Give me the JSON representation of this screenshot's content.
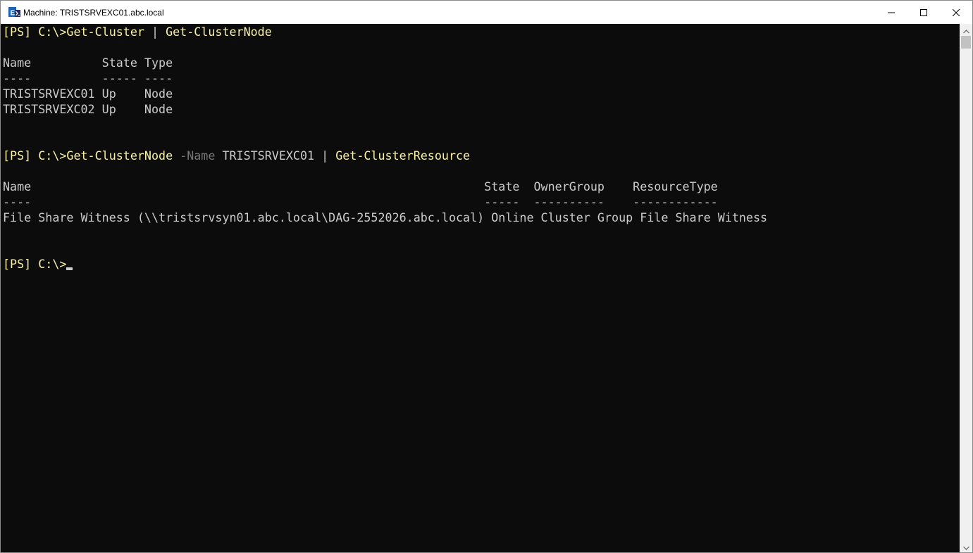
{
  "window": {
    "title": "Machine: TRISTSRVEXC01.abc.local",
    "icon": "exchange-management-shell-icon",
    "controls": [
      "minimize-icon",
      "maximize-icon",
      "close-icon"
    ]
  },
  "console": {
    "colors": {
      "background": "#0c0c0c",
      "text": "#cccccc",
      "command": "#f9f1a5",
      "parameter": "#767676"
    },
    "lines": {
      "l1": {
        "prompt": "[PS] C:\\>",
        "cmd1": "Get-Cluster",
        "pipe": " | ",
        "cmd2": "Get-ClusterNode"
      },
      "l3": "Name          State Type",
      "l4": "----          ----- ----",
      "l5": "TRISTSRVEXC01 Up    Node",
      "l6": "TRISTSRVEXC02 Up    Node",
      "l9": {
        "prompt": "[PS] C:\\>",
        "cmd1": "Get-ClusterNode",
        "param": " -Name",
        "arg": " TRISTSRVEXC01",
        "pipe": " | ",
        "cmd2": "Get-ClusterResource"
      },
      "l11": "Name                                                                State  OwnerGroup    ResourceType",
      "l12": "----                                                                -----  ----------    ------------",
      "l13": "File Share Witness (\\\\tristsrvsyn01.abc.local\\DAG-2552026.abc.local) Online Cluster Group File Share Witness",
      "l16": {
        "prompt": "[PS] C:\\>"
      }
    }
  }
}
